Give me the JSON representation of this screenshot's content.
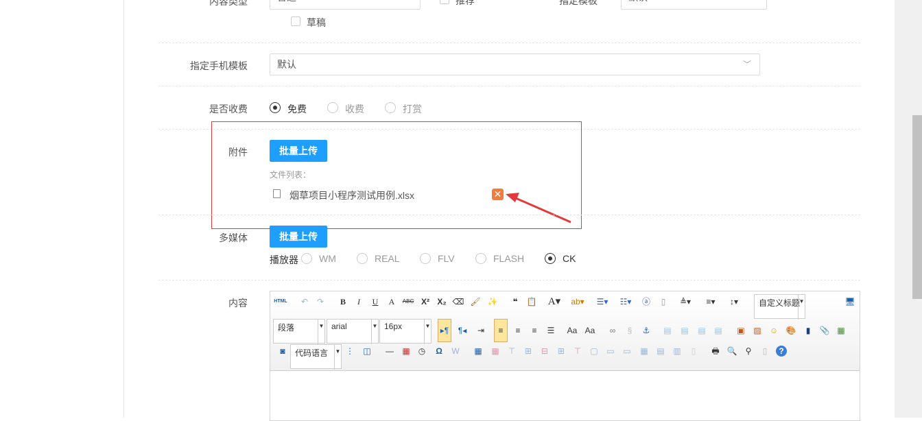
{
  "row_top": {
    "content_type_label": "内容类型",
    "content_type_value": "普通",
    "recommend_label": "推荐",
    "template_label": "指定模板",
    "template_value": "默认",
    "draft_label": "草稿"
  },
  "mobile_template": {
    "label": "指定手机模板",
    "value": "默认"
  },
  "fee": {
    "label": "是否收费",
    "options": [
      "免费",
      "收费",
      "打赏"
    ],
    "selected": 0
  },
  "attachment": {
    "label": "附件",
    "upload_button": "批量上传",
    "file_list_label": "文件列表：",
    "files": [
      "烟草项目小程序测试用例.xlsx"
    ]
  },
  "media": {
    "label": "多媒体",
    "upload_button": "批量上传",
    "player_label": "播放器",
    "players": [
      "WM",
      "REAL",
      "FLV",
      "FLASH",
      "CK"
    ],
    "selected": 4
  },
  "content": {
    "label": "内容",
    "html_label": "HTML",
    "custom_title": "自定义标题",
    "paragraph": "段落",
    "font": "arial",
    "size": "16px",
    "code_lang": "代码语言"
  },
  "colors": {
    "accent": "#1e9fff",
    "highlight": "#e4393c"
  }
}
